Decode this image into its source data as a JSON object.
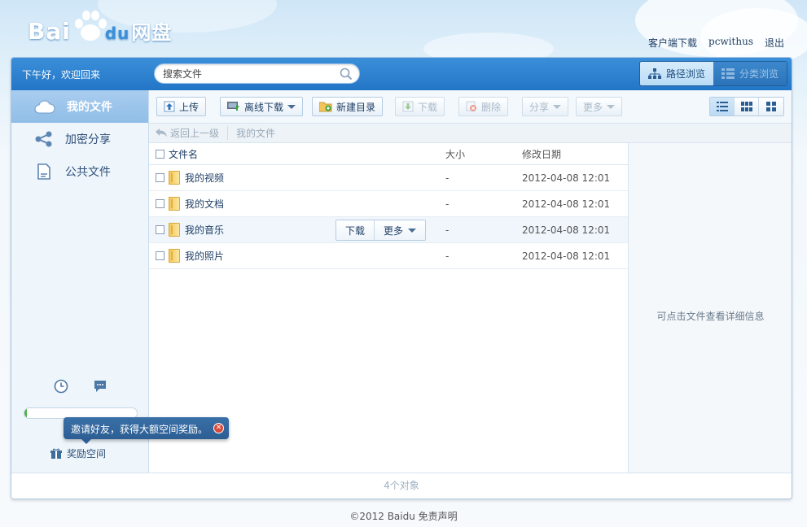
{
  "brand": {
    "name_part1": "Bai",
    "name_part2": "du",
    "name_part3": "网盘"
  },
  "top_links": {
    "client_download": "客户端下载",
    "username": "pcwithus",
    "logout": "退出"
  },
  "header": {
    "greeting": "下午好，欢迎回来",
    "search_placeholder": "搜索文件",
    "view_tabs": [
      {
        "label": "路径浏览",
        "active": true
      },
      {
        "label": "分类浏览",
        "active": false
      }
    ]
  },
  "sidebar": {
    "items": [
      {
        "label": "我的文件",
        "icon": "cloud-icon",
        "active": true
      },
      {
        "label": "加密分享",
        "icon": "share-icon",
        "active": false
      },
      {
        "label": "公共文件",
        "icon": "document-icon",
        "active": false
      }
    ],
    "quota_used_fraction": 0.02,
    "tooltip": "邀请好友，获得大额空间奖励。",
    "reward_label": "奖励空间"
  },
  "toolbar": {
    "upload": "上传",
    "offline_download": "离线下载",
    "new_folder": "新建目录",
    "download": "下载",
    "delete": "删除",
    "share": "分享",
    "more": "更多"
  },
  "breadcrumb": {
    "back": "返回上一级",
    "current": "我的文件"
  },
  "table": {
    "columns": {
      "name": "文件名",
      "size": "大小",
      "modified": "修改日期"
    },
    "rows": [
      {
        "name": "我的视频",
        "size": "-",
        "modified": "2012-04-08 12:01"
      },
      {
        "name": "我的文档",
        "size": "-",
        "modified": "2012-04-08 12:01"
      },
      {
        "name": "我的音乐",
        "size": "-",
        "modified": "2012-04-08 12:01"
      },
      {
        "name": "我的照片",
        "size": "-",
        "modified": "2012-04-08 12:01"
      }
    ],
    "row_actions": {
      "download": "下载",
      "more": "更多"
    }
  },
  "detail_panel": {
    "hint": "可点击文件查看详细信息"
  },
  "status": {
    "count": "4个对象"
  },
  "footer": {
    "text": "©2012 Baidu 免责声明"
  },
  "colors": {
    "header_blue": "#2b80cf",
    "sidebar_active": "#9ec6ec",
    "link": "#1f3f63"
  }
}
